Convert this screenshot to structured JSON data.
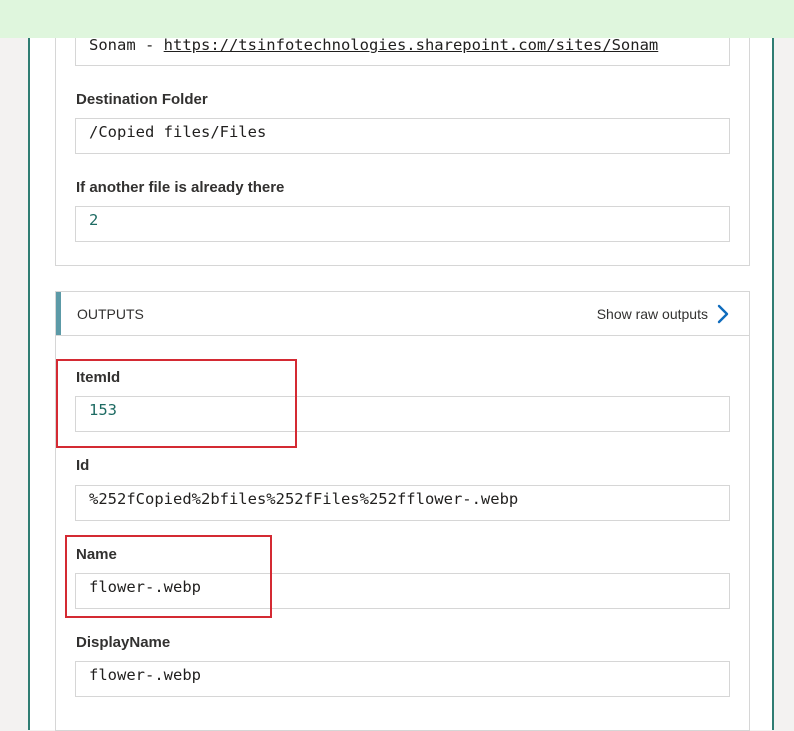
{
  "inputs": {
    "site": {
      "prefix": "Sonam - ",
      "url": "https://tsinfotechnologies.sharepoint.com/sites/Sonam"
    },
    "destination_folder": {
      "label": "Destination Folder",
      "value": "/Copied files/Files"
    },
    "conflict": {
      "label": "If another file is already there",
      "value": "2"
    }
  },
  "outputs": {
    "title": "OUTPUTS",
    "raw_link": "Show raw outputs",
    "fields": [
      {
        "label": "ItemId",
        "value": "153"
      },
      {
        "label": "Id",
        "value": "%252fCopied%2bfiles%252fFiles%252fflower-.webp"
      },
      {
        "label": "Name",
        "value": "flower-.webp"
      },
      {
        "label": "DisplayName",
        "value": "flower-.webp"
      }
    ]
  },
  "colors": {
    "banner": "#dff6dd",
    "card_border": "#2f7d73",
    "header_accent": "#5c9aa7",
    "highlight": "#d42a33",
    "chevron": "#0f6cbd"
  }
}
